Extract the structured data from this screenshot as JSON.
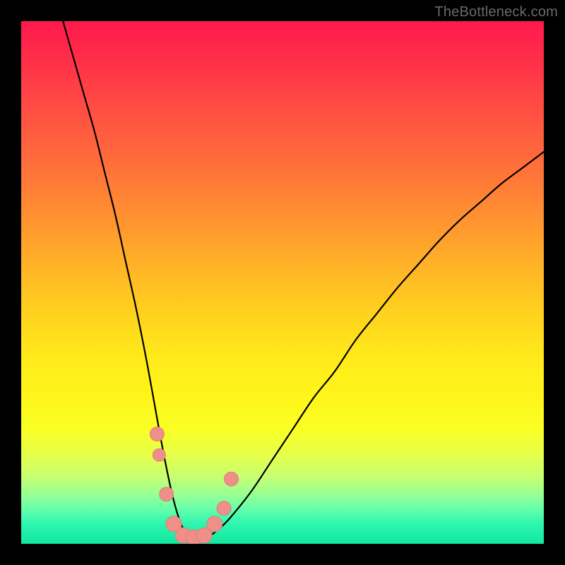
{
  "attribution": "TheBottleneck.com",
  "colors": {
    "frame": "#000000",
    "curve": "#000000",
    "marker_fill": "#ef8f8a",
    "marker_stroke": "#e17e78"
  },
  "chart_data": {
    "type": "line",
    "title": "",
    "xlabel": "",
    "ylabel": "",
    "xlim": [
      0,
      100
    ],
    "ylim": [
      0,
      100
    ],
    "series": [
      {
        "name": "curve",
        "x": [
          8,
          10,
          12,
          14,
          16,
          18,
          20,
          22,
          24,
          26,
          27.5,
          29,
          30.5,
          32,
          34,
          36,
          38,
          40,
          44,
          48,
          52,
          56,
          60,
          64,
          68,
          72,
          76,
          80,
          84,
          88,
          92,
          96,
          100
        ],
        "y": [
          100,
          93,
          86,
          79,
          71,
          63,
          54,
          45,
          35,
          24,
          16,
          9,
          4,
          1.5,
          1,
          1.5,
          3,
          5,
          10,
          16,
          22,
          28,
          33,
          39,
          44,
          49,
          53.5,
          58,
          62,
          65.5,
          69,
          72,
          75
        ]
      }
    ],
    "markers": [
      {
        "x": 26.0,
        "y": 21.0,
        "r": 10
      },
      {
        "x": 26.4,
        "y": 17.0,
        "r": 9
      },
      {
        "x": 27.8,
        "y": 9.5,
        "r": 10
      },
      {
        "x": 29.2,
        "y": 3.8,
        "r": 11
      },
      {
        "x": 31.0,
        "y": 1.6,
        "r": 11
      },
      {
        "x": 33.0,
        "y": 1.2,
        "r": 11
      },
      {
        "x": 35.0,
        "y": 1.6,
        "r": 11
      },
      {
        "x": 37.0,
        "y": 3.8,
        "r": 11
      },
      {
        "x": 38.8,
        "y": 6.8,
        "r": 10
      },
      {
        "x": 40.2,
        "y": 12.4,
        "r": 10
      }
    ]
  }
}
